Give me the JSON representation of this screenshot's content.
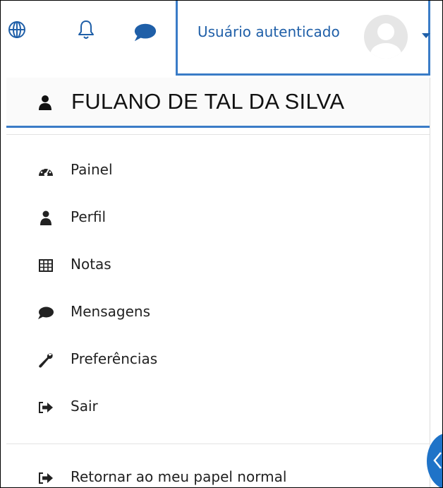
{
  "navbar": {
    "icons": [
      "globe-icon",
      "bell-icon",
      "chat-icon"
    ],
    "user_label": "Usuário autenticado"
  },
  "dropdown": {
    "header_name": "FULANO DE TAL DA SILVA",
    "items": [
      {
        "label": "Painel",
        "icon": "dashboard-icon"
      },
      {
        "label": "Perfil",
        "icon": "user-icon"
      },
      {
        "label": "Notas",
        "icon": "table-icon"
      },
      {
        "label": "Mensagens",
        "icon": "chat-icon"
      },
      {
        "label": "Preferências",
        "icon": "wrench-icon"
      },
      {
        "label": "Sair",
        "icon": "sign-out-icon"
      }
    ],
    "footer_item": {
      "label": "Retornar ao meu papel normal",
      "icon": "sign-out-icon"
    }
  },
  "colors": {
    "accent": "#3a7cc7",
    "link": "#1f5fa8",
    "side_button": "#1f73c8"
  }
}
